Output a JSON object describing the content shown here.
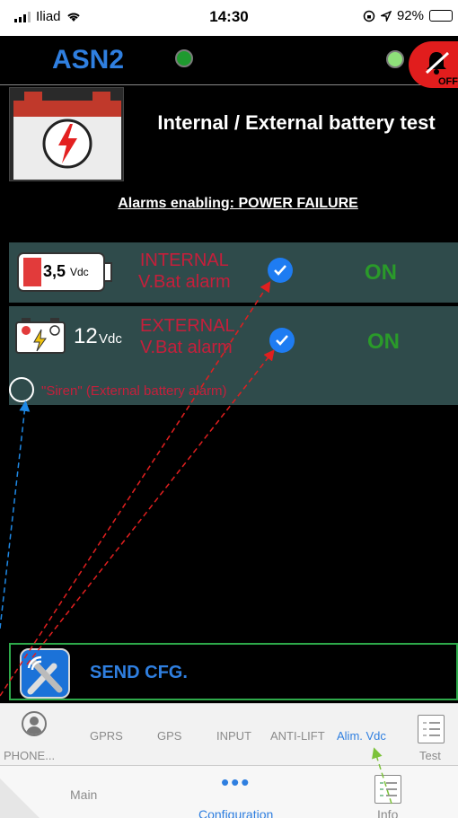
{
  "status_bar": {
    "carrier": "Iliad",
    "time": "14:30",
    "battery": "92%"
  },
  "header": {
    "title": "ASN2",
    "alarm_button_label": "OFF"
  },
  "section": {
    "title": "Internal / External battery test",
    "alarms_enabling": "Alarms enabling: POWER FAILURE"
  },
  "internal": {
    "icon_text": "3,5",
    "icon_unit": "Vdc",
    "label_line1": "INTERNAL",
    "label_line2": "V.Bat alarm",
    "state": "ON"
  },
  "external": {
    "icon_text": "12",
    "icon_unit": "Vdc",
    "label_line1": "EXTERNAL",
    "label_line2": "V.Bat alarm",
    "state": "ON"
  },
  "siren": {
    "label": "\"Siren\" (External battery alarm)"
  },
  "send": {
    "label": "SEND CFG."
  },
  "subtabs": [
    {
      "label": "PHONE..."
    },
    {
      "label": "GPRS"
    },
    {
      "label": "GPS"
    },
    {
      "label": "INPUT"
    },
    {
      "label": "ANTI-LIFT"
    },
    {
      "label": "Alim. Vdc"
    },
    {
      "label": "Test"
    }
  ],
  "maintabs": [
    {
      "label": "Main"
    },
    {
      "label": "Configuration"
    },
    {
      "label": "Info"
    }
  ],
  "colors": {
    "accent": "#2f7fe0",
    "alarm_red": "#c51f3b",
    "on_green": "#2a9a2a",
    "panel": "#2f4b4b"
  }
}
